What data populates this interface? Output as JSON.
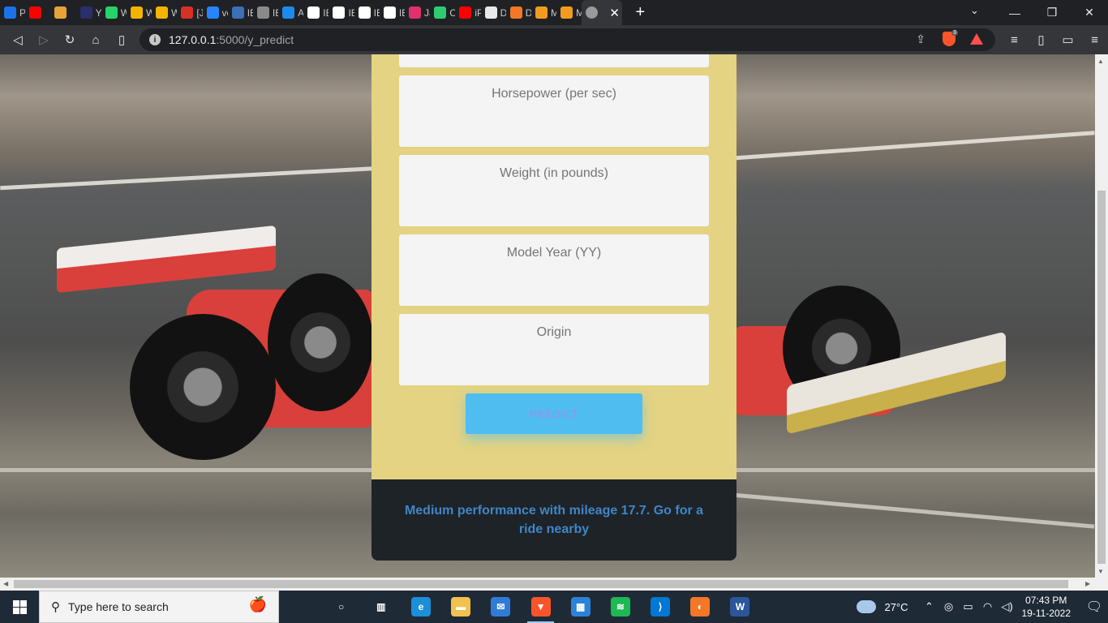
{
  "browser": {
    "tabs": [
      {
        "label": "Pri",
        "icon": "play-icon",
        "color": "#1a73e8"
      },
      {
        "label": "",
        "icon": "youtube-icon",
        "color": "#ff0000"
      },
      {
        "label": "",
        "icon": "emoji-icon",
        "color": "#e7a23a"
      },
      {
        "label": "Yel",
        "icon": "eh-icon",
        "color": "#2b2f6a"
      },
      {
        "label": "Wa",
        "icon": "whatsapp-icon",
        "color": "#25d366"
      },
      {
        "label": "Wa",
        "icon": "colorful-icon",
        "color": "#f4b400"
      },
      {
        "label": "Wa",
        "icon": "colorful-icon",
        "color": "#f4b400"
      },
      {
        "label": "[JIF",
        "icon": "gmail-icon",
        "color": "#d93025"
      },
      {
        "label": "vec",
        "icon": "diamond-icon",
        "color": "#2684ff"
      },
      {
        "label": "IBN",
        "icon": "cloud-icon",
        "color": "#3b6fb6"
      },
      {
        "label": "IBN",
        "icon": "globe-icon",
        "color": "#8a8a8a"
      },
      {
        "label": "AD",
        "icon": "v-icon",
        "color": "#1b8ceb"
      },
      {
        "label": "IBN",
        "icon": "github-icon",
        "color": "#ffffff"
      },
      {
        "label": "IBN",
        "icon": "github-icon",
        "color": "#ffffff"
      },
      {
        "label": "IBN",
        "icon": "github-icon",
        "color": "#ffffff"
      },
      {
        "label": "IBN",
        "icon": "github-icon",
        "color": "#ffffff"
      },
      {
        "label": "Jav",
        "icon": "fn-icon",
        "color": "#e1306c"
      },
      {
        "label": "CS",
        "icon": "w-icon",
        "color": "#2ecc71"
      },
      {
        "label": "iPh",
        "icon": "youtube-icon",
        "color": "#ff0000"
      },
      {
        "label": "Do",
        "icon": "download-icon",
        "color": "#e8e8e8"
      },
      {
        "label": "Do",
        "icon": "jupyter-icon",
        "color": "#f37726"
      },
      {
        "label": "Mc",
        "icon": "book-icon",
        "color": "#f29c1f"
      },
      {
        "label": "Mc",
        "icon": "book-icon",
        "color": "#f29c1f"
      }
    ],
    "active_tab_icon": "globe-icon",
    "url_host": "127.0.0.1",
    "url_path": ":5000/y_predict",
    "brave_badge": "3"
  },
  "form": {
    "fields": [
      {
        "placeholder": "Horsepower (per sec)"
      },
      {
        "placeholder": "Weight (in pounds)"
      },
      {
        "placeholder": "Model Year (YY)"
      },
      {
        "placeholder": "Origin"
      }
    ],
    "predict_label": "PREDICT",
    "result_text": "Medium performance with mileage 17.7. Go for a ride nearby"
  },
  "taskbar": {
    "search_placeholder": "Type here to search",
    "temperature": "27°C",
    "time": "07:43 PM",
    "date": "19-11-2022",
    "apps": [
      {
        "name": "cortana-icon",
        "glyph": "○",
        "color": "transparent"
      },
      {
        "name": "task-view-icon",
        "glyph": "▥",
        "color": "transparent"
      },
      {
        "name": "edge-icon",
        "glyph": "e",
        "color": "#1b8fd8"
      },
      {
        "name": "file-explorer-icon",
        "glyph": "▬",
        "color": "#f2c14e"
      },
      {
        "name": "mail-icon",
        "glyph": "✉",
        "color": "#2f7cd8"
      },
      {
        "name": "brave-icon",
        "glyph": "▼",
        "color": "#fb542b"
      },
      {
        "name": "store-icon",
        "glyph": "▦",
        "color": "#2b83d8"
      },
      {
        "name": "spotify-icon",
        "glyph": "≋",
        "color": "#1db954"
      },
      {
        "name": "vscode-icon",
        "glyph": "⟩",
        "color": "#0078d4"
      },
      {
        "name": "jupyter-icon",
        "glyph": "◐",
        "color": "#f37726"
      },
      {
        "name": "word-icon",
        "glyph": "W",
        "color": "#2b579a"
      }
    ]
  }
}
